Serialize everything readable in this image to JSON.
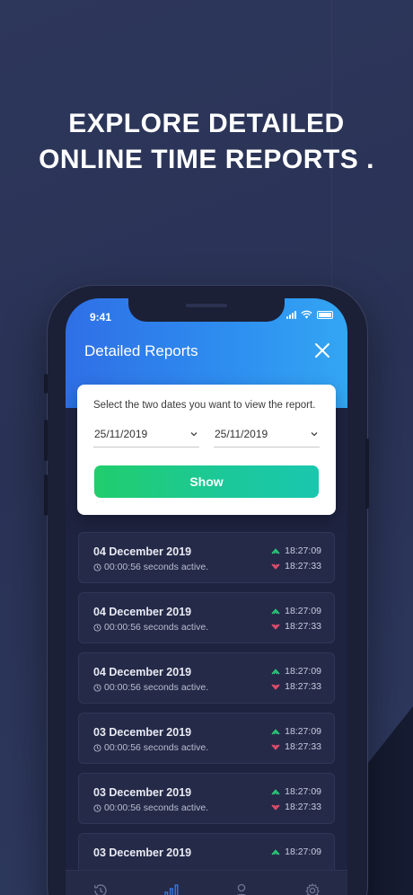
{
  "headline": {
    "line1": "EXPLORE DETAILED",
    "line2": "ONLINE TIME REPORTS ."
  },
  "status_bar": {
    "time": "9:41"
  },
  "header": {
    "title": "Detailed Reports"
  },
  "date_picker": {
    "prompt": "Select the two dates you want to view the report.",
    "start_date": "25/11/2019",
    "end_date": "25/11/2019",
    "show_label": "Show"
  },
  "reports": [
    {
      "date": "04 December 2019",
      "active": "00:00:56 seconds active.",
      "up_time": "18:27:09",
      "down_time": "18:27:33"
    },
    {
      "date": "04 December 2019",
      "active": "00:00:56 seconds active.",
      "up_time": "18:27:09",
      "down_time": "18:27:33"
    },
    {
      "date": "04 December 2019",
      "active": "00:00:56 seconds active.",
      "up_time": "18:27:09",
      "down_time": "18:27:33"
    },
    {
      "date": "03 December 2019",
      "active": "00:00:56 seconds active.",
      "up_time": "18:27:09",
      "down_time": "18:27:33"
    },
    {
      "date": "03 December 2019",
      "active": "00:00:56 seconds active.",
      "up_time": "18:27:09",
      "down_time": "18:27:33"
    },
    {
      "date": "03 December 2019",
      "active": "",
      "up_time": "18:27:09",
      "down_time": ""
    }
  ],
  "tabs": [
    {
      "icon": "history-icon",
      "active": false
    },
    {
      "icon": "bar-chart-icon",
      "active": true
    },
    {
      "icon": "user-icon",
      "active": false
    },
    {
      "icon": "gear-icon",
      "active": false
    }
  ],
  "colors": {
    "background": "#2b3557",
    "header_gradient_start": "#2f6fe6",
    "header_gradient_end": "#33a6f3",
    "show_button": "#21cd6c",
    "up_arrow": "#2ad07a",
    "down_arrow": "#f0506e",
    "active_tab": "#3a7bf0"
  }
}
